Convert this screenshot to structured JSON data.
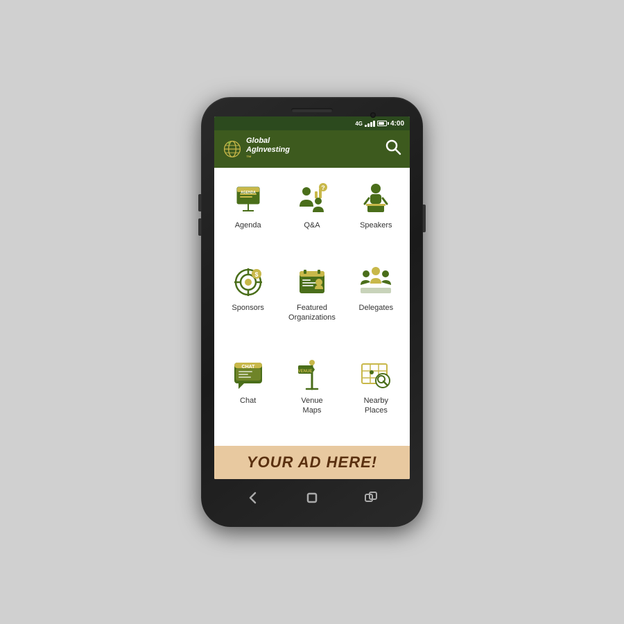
{
  "phone": {
    "status": {
      "network": "4G",
      "time": "4:00",
      "signal_label": "signal",
      "battery_label": "battery"
    },
    "header": {
      "logo_line1": "Global",
      "logo_line2": "AgInvesting",
      "search_icon": "search"
    },
    "grid": {
      "rows": [
        [
          {
            "id": "agenda",
            "label": "Agenda",
            "icon": "agenda"
          },
          {
            "id": "qa",
            "label": "Q&A",
            "icon": "qa"
          },
          {
            "id": "speakers",
            "label": "Speakers",
            "icon": "speakers"
          }
        ],
        [
          {
            "id": "sponsors",
            "label": "Sponsors",
            "icon": "sponsors"
          },
          {
            "id": "featured-orgs",
            "label": "Featured\nOrganizations",
            "icon": "featured-orgs"
          },
          {
            "id": "delegates",
            "label": "Delegates",
            "icon": "delegates"
          }
        ],
        [
          {
            "id": "chat",
            "label": "Chat",
            "icon": "chat"
          },
          {
            "id": "venue-maps",
            "label": "Venue\nMaps",
            "icon": "venue-maps"
          },
          {
            "id": "nearby-places",
            "label": "Nearby\nPlaces",
            "icon": "nearby-places"
          }
        ]
      ]
    },
    "ad": {
      "text": "YOUR AD HERE!"
    },
    "nav": {
      "back_icon": "back",
      "home_icon": "home",
      "recents_icon": "recents"
    }
  }
}
